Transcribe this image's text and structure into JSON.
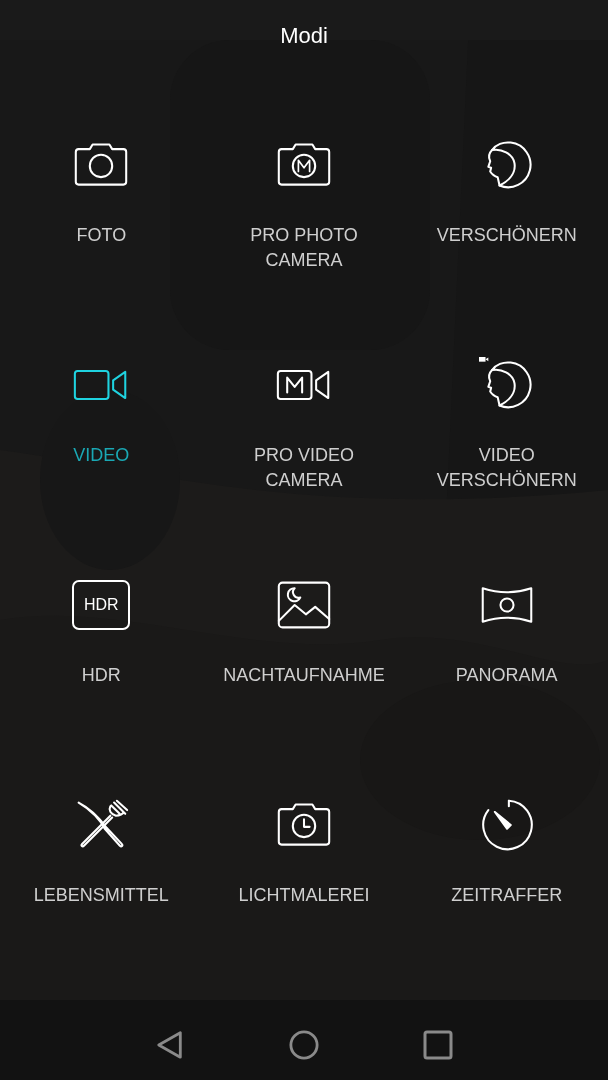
{
  "title": "Modi",
  "modes": [
    {
      "label": "FOTO",
      "kind": "camera",
      "selected": false
    },
    {
      "label": "PRO PHOTO\nCAMERA",
      "kind": "pro-camera",
      "selected": false
    },
    {
      "label": "VERSCHÖNERN",
      "kind": "beauty",
      "selected": false
    },
    {
      "label": "VIDEO",
      "kind": "video",
      "selected": true
    },
    {
      "label": "PRO VIDEO\nCAMERA",
      "kind": "pro-video",
      "selected": false
    },
    {
      "label": "VIDEO\nVERSCHÖNERN",
      "kind": "beauty-video",
      "selected": false
    },
    {
      "label": "HDR",
      "kind": "hdr",
      "badge": "HDR",
      "selected": false
    },
    {
      "label": "NACHTAUFNAHME",
      "kind": "night",
      "selected": false
    },
    {
      "label": "PANORAMA",
      "kind": "panorama",
      "selected": false
    },
    {
      "label": "LEBENSMITTEL",
      "kind": "food",
      "selected": false
    },
    {
      "label": "LICHTMALEREI",
      "kind": "light-painting",
      "selected": false
    },
    {
      "label": "ZEITRAFFER",
      "kind": "timelapse",
      "selected": false
    }
  ]
}
